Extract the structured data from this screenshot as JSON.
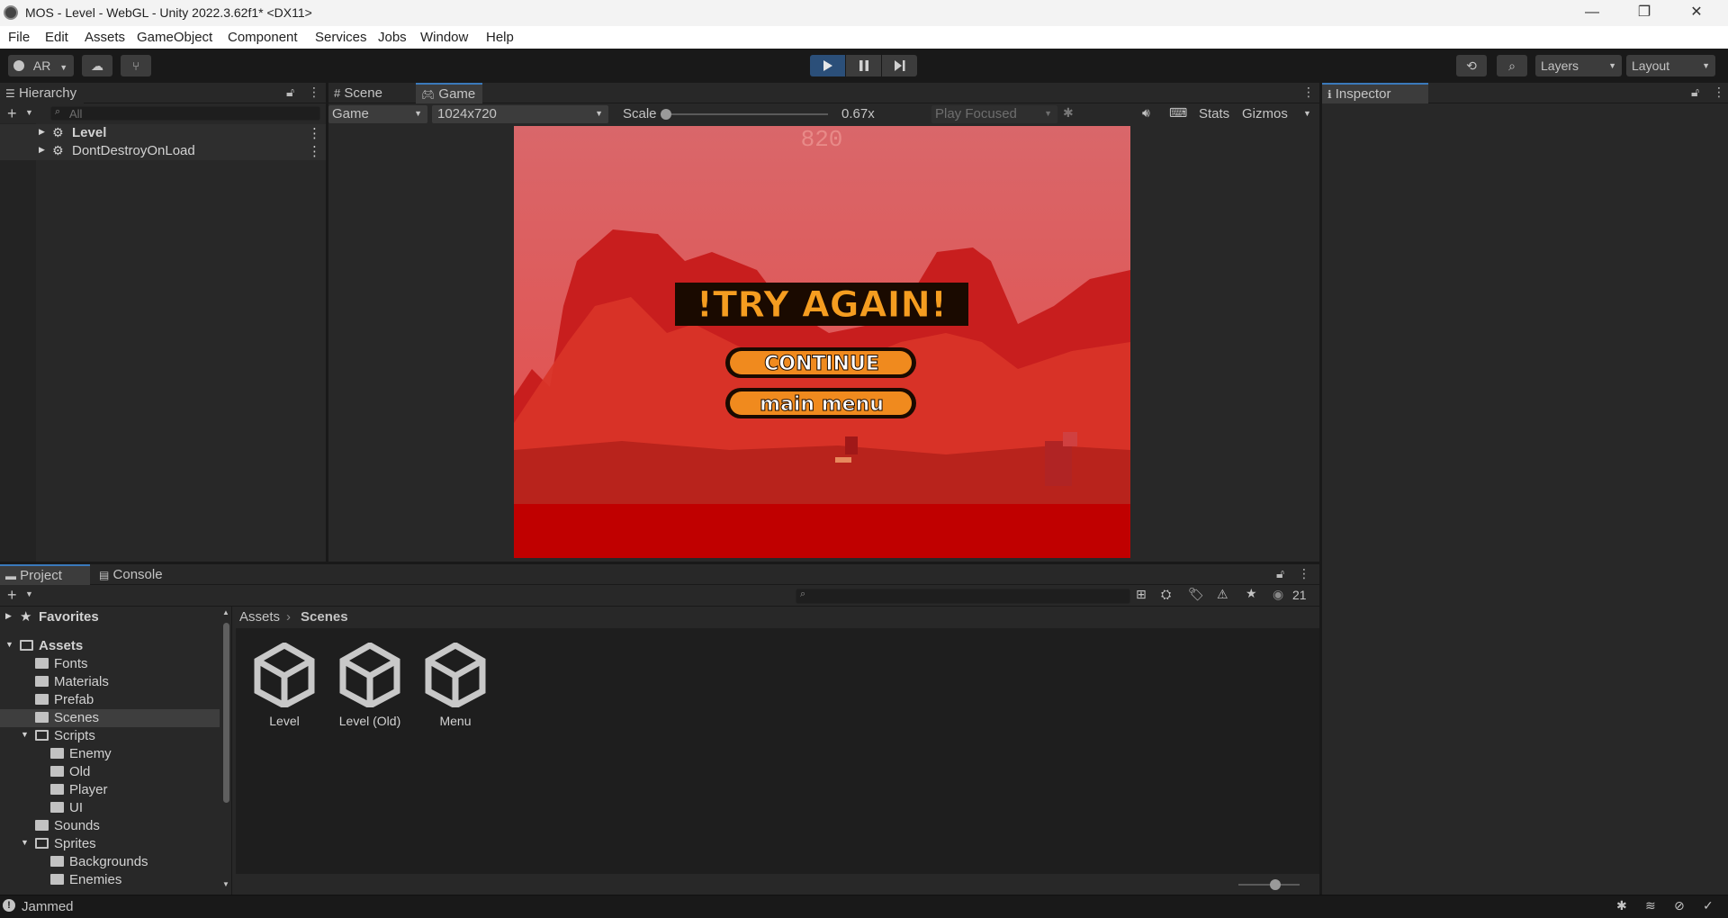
{
  "window": {
    "title": "MOS - Level - WebGL - Unity 2022.3.62f1* <DX11>",
    "minimize": "—",
    "restore": "❐",
    "close": "✕"
  },
  "menu": [
    "File",
    "Edit",
    "Assets",
    "GameObject",
    "Component",
    "Services",
    "Jobs",
    "Window",
    "Help"
  ],
  "toolbar": {
    "account": "AR",
    "layers": "Layers",
    "layout": "Layout"
  },
  "hierarchy": {
    "tab": "Hierarchy",
    "search_placeholder": "All",
    "items": [
      "Level",
      "DontDestroyOnLoad"
    ]
  },
  "game": {
    "tabs": [
      "Scene",
      "Game"
    ],
    "display": "Game",
    "resolution": "1024x720",
    "scale_label": "Scale",
    "scale_value": "0.67x",
    "scale_level": 0,
    "play_mode": "Play Focused",
    "stats": "Stats",
    "gizmos": "Gizmos",
    "score": "820",
    "headline": "!TRY AGAIN!",
    "continue": "CONTINUE",
    "main_menu": "main menu"
  },
  "inspector": {
    "tab": "Inspector"
  },
  "project": {
    "tabs": [
      "Project",
      "Console"
    ],
    "badge_count": "21",
    "favorites": "Favorites",
    "breadcrumb": [
      "Assets",
      "Scenes"
    ],
    "tree": [
      {
        "label": "Assets",
        "depth": 0,
        "open": true,
        "bold": true
      },
      {
        "label": "Fonts",
        "depth": 1
      },
      {
        "label": "Materials",
        "depth": 1
      },
      {
        "label": "Prefab",
        "depth": 1
      },
      {
        "label": "Scenes",
        "depth": 1,
        "selected": true
      },
      {
        "label": "Scripts",
        "depth": 1,
        "open": true
      },
      {
        "label": "Enemy",
        "depth": 2
      },
      {
        "label": "Old",
        "depth": 2
      },
      {
        "label": "Player",
        "depth": 2
      },
      {
        "label": "UI",
        "depth": 2
      },
      {
        "label": "Sounds",
        "depth": 1
      },
      {
        "label": "Sprites",
        "depth": 1,
        "open": true
      },
      {
        "label": "Backgrounds",
        "depth": 2
      },
      {
        "label": "Enemies",
        "depth": 2
      }
    ],
    "assets": [
      "Level",
      "Level (Old)",
      "Menu"
    ],
    "icon_size_level": 0.6
  },
  "status": {
    "message": "Jammed"
  },
  "colors": {
    "accent": "#3a79bb",
    "panel": "#282828",
    "game_sky": "#d9676a",
    "game_ground": "#c00000",
    "button_orange": "#f08a1e"
  }
}
